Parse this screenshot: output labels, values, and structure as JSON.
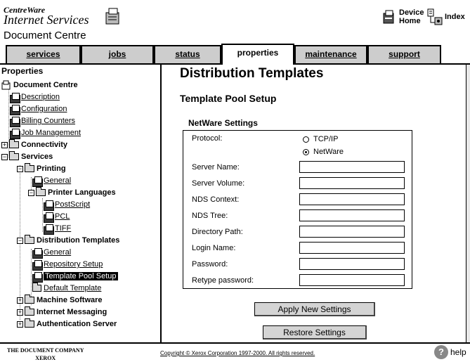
{
  "header": {
    "brand_line1": "CentreWare",
    "brand_line2": "Internet Services",
    "device_name": "Document Centre",
    "device_home_label": "Device Home",
    "index_label": "Index"
  },
  "tabs": [
    {
      "label": "services",
      "active": false
    },
    {
      "label": "jobs",
      "active": false
    },
    {
      "label": "status",
      "active": false
    },
    {
      "label": "properties",
      "active": true
    },
    {
      "label": "maintenance",
      "active": false
    },
    {
      "label": "support",
      "active": false
    }
  ],
  "sidebar": {
    "title": "Properties",
    "root": "Document Centre",
    "items": [
      {
        "label": "Description",
        "type": "page"
      },
      {
        "label": "Configuration",
        "type": "page"
      },
      {
        "label": "Billing Counters",
        "type": "page"
      },
      {
        "label": "Job Management",
        "type": "page"
      },
      {
        "label": "Connectivity",
        "type": "folder"
      },
      {
        "label": "Services",
        "type": "folder"
      },
      {
        "label": "Printing",
        "type": "folder"
      },
      {
        "label": "General",
        "type": "page"
      },
      {
        "label": "Printer Languages",
        "type": "folder"
      },
      {
        "label": "PostScript",
        "type": "page"
      },
      {
        "label": "PCL",
        "type": "page"
      },
      {
        "label": "TIFF",
        "type": "page"
      },
      {
        "label": "Distribution Templates",
        "type": "folder"
      },
      {
        "label": "General",
        "type": "page"
      },
      {
        "label": "Repository Setup",
        "type": "page"
      },
      {
        "label": "Template Pool Setup",
        "type": "page",
        "selected": true
      },
      {
        "label": "Default Template",
        "type": "page"
      },
      {
        "label": "Machine Software",
        "type": "folder"
      },
      {
        "label": "Internet Messaging",
        "type": "folder"
      },
      {
        "label": "Authentication Server",
        "type": "folder"
      }
    ]
  },
  "main": {
    "title": "Distribution Templates",
    "subtitle": "Template Pool Setup",
    "section_title": "NetWare Settings",
    "protocol": {
      "label": "Protocol:",
      "options": [
        "TCP/IP",
        "NetWare"
      ],
      "selected": "NetWare"
    },
    "fields": [
      {
        "label": "Server Name:",
        "value": ""
      },
      {
        "label": "Server Volume:",
        "value": ""
      },
      {
        "label": "NDS Context:",
        "value": ""
      },
      {
        "label": "NDS Tree:",
        "value": ""
      },
      {
        "label": "Directory Path:",
        "value": ""
      },
      {
        "label": "Login Name:",
        "value": ""
      },
      {
        "label": "Password:",
        "value": ""
      },
      {
        "label": "Retype password:",
        "value": ""
      }
    ],
    "apply_button": "Apply New Settings",
    "restore_button": "Restore Settings"
  },
  "footer": {
    "company_line1": "THE DOCUMENT COMPANY",
    "company_line2": "XEROX",
    "copyright": "Copyright © Xerox Corporation 1997-2000. All rights reserved.",
    "help": "help"
  }
}
